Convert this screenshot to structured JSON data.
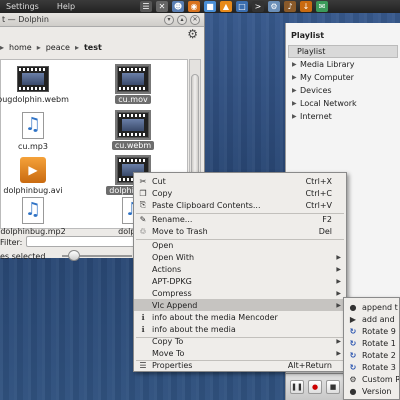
{
  "top_panel": {
    "menus": [
      "Settings",
      "Help"
    ],
    "icons": [
      "menu-icon",
      "close-icon",
      "user-icon",
      "firefox-icon",
      "app-icon",
      "vlc-icon",
      "files-icon",
      "terminal-icon",
      "system-icon",
      "media-icon",
      "download-icon",
      "chat-icon"
    ]
  },
  "dolphin": {
    "title": "t — Dolphin",
    "breadcrumb": [
      "home",
      "peace",
      "test"
    ],
    "files": [
      {
        "name": "bugdolphin.webm",
        "icon": "video"
      },
      {
        "name": "cu.mov",
        "icon": "video"
      },
      {
        "name": "cu.mp3",
        "icon": "audio"
      },
      {
        "name": "cu.webm",
        "icon": "video"
      },
      {
        "name": "dolphinbug.avi",
        "icon": "avi"
      },
      {
        "name": "dolphinbu...",
        "icon": "video"
      },
      {
        "name": "dolphinbug.mp2",
        "icon": "audio"
      },
      {
        "name": "dolphin",
        "icon": "audio"
      }
    ],
    "filter_label": "Filter:",
    "status_text": "es selected"
  },
  "vlc": {
    "header": "Playlist",
    "items": [
      {
        "label": "Playlist",
        "selected": true
      },
      {
        "label": "Media Library",
        "selected": false
      },
      {
        "label": "My Computer",
        "selected": false
      },
      {
        "label": "Devices",
        "selected": false
      },
      {
        "label": "Local Network",
        "selected": false
      },
      {
        "label": "Internet",
        "selected": false
      }
    ]
  },
  "context_menu": {
    "items": [
      {
        "label": "Cut",
        "shortcut": "Ctrl+X",
        "icon": "✂"
      },
      {
        "label": "Copy",
        "shortcut": "Ctrl+C",
        "icon": "❐"
      },
      {
        "label": "Paste Clipboard Contents...",
        "shortcut": "Ctrl+V",
        "icon": "⎘"
      },
      {
        "label": "Rename...",
        "shortcut": "F2",
        "icon": "✎"
      },
      {
        "label": "Move to Trash",
        "shortcut": "Del",
        "icon": "♲"
      },
      {
        "label": "Open",
        "shortcut": "",
        "icon": ""
      },
      {
        "label": "Open With",
        "shortcut": "",
        "icon": "",
        "submenu": true
      },
      {
        "label": "Actions",
        "shortcut": "",
        "icon": "",
        "submenu": true
      },
      {
        "label": "APT-DPKG",
        "shortcut": "",
        "icon": "",
        "submenu": true
      },
      {
        "label": "Compress",
        "shortcut": "",
        "icon": "",
        "submenu": true
      },
      {
        "label": "Vlc Append",
        "shortcut": "",
        "icon": "",
        "submenu": true
      },
      {
        "label": "info about the media Mencoder",
        "shortcut": "",
        "icon": "ℹ"
      },
      {
        "label": "info about the media",
        "shortcut": "",
        "icon": "ℹ"
      },
      {
        "label": "Copy To",
        "shortcut": "",
        "icon": "",
        "submenu": true
      },
      {
        "label": "Move To",
        "shortcut": "",
        "icon": "",
        "submenu": true
      },
      {
        "label": "Properties",
        "shortcut": "Alt+Return",
        "icon": "☰"
      }
    ]
  },
  "submenu": {
    "items": [
      {
        "label": "append t",
        "icon": "●"
      },
      {
        "label": "add and",
        "icon": "▶"
      },
      {
        "label": "Rotate 9",
        "icon": "↻"
      },
      {
        "label": "Rotate 1",
        "icon": "↻"
      },
      {
        "label": "Rotate 2",
        "icon": "↻"
      },
      {
        "label": "Rotate 3",
        "icon": "↻"
      },
      {
        "label": "Custom R",
        "icon": "⚙"
      },
      {
        "label": "Version",
        "icon": "●"
      }
    ]
  }
}
